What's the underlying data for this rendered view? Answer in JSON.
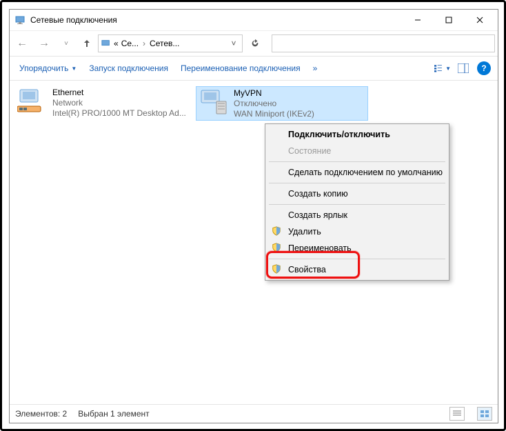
{
  "title": "Сетевые подключения",
  "breadcrumb": {
    "prefix": "«",
    "seg1": "Се...",
    "seg2": "Сетев..."
  },
  "toolbar": {
    "organize": "Упорядочить",
    "start": "Запуск подключения",
    "rename": "Переименование подключения",
    "overflow": "»"
  },
  "connections": [
    {
      "name": "Ethernet",
      "line2": "Network",
      "line3": "Intel(R) PRO/1000 MT Desktop Ad..."
    },
    {
      "name": "MyVPN",
      "line2": "Отключено",
      "line3": "WAN Miniport (IKEv2)"
    }
  ],
  "menu": {
    "connect": "Подключить/отключить",
    "status": "Состояние",
    "default": "Сделать подключением по умолчанию",
    "copy": "Создать копию",
    "shortcut": "Создать ярлык",
    "delete": "Удалить",
    "rename": "Переименовать",
    "properties": "Свойства"
  },
  "status": {
    "count_label": "Элементов:",
    "count": "2",
    "selected_label": "Выбран 1 элемент"
  }
}
